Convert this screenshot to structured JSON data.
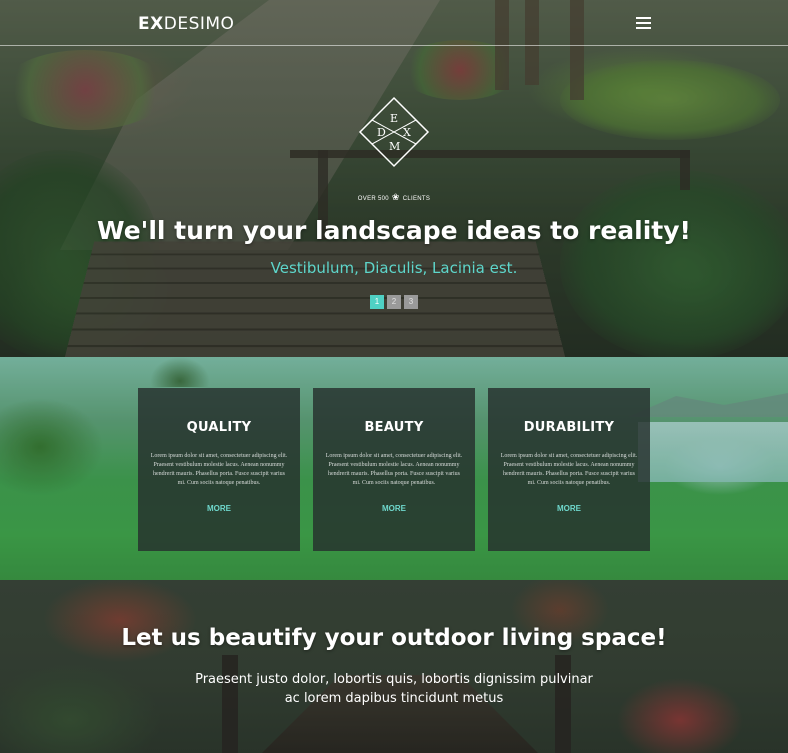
{
  "header": {
    "logo_bold": "EX",
    "logo_light": "DESIMO",
    "menu_icon": "hamburger-menu-icon"
  },
  "hero": {
    "emblem_letters": {
      "top": "E",
      "left": "D",
      "right": "X",
      "bottom": "M"
    },
    "clients_left": "OVER 500",
    "clients_right": "CLIENTS",
    "title": "We'll turn your landscape ideas to reality!",
    "subtitle": "Vestibulum, Diaculis, Lacinia est.",
    "pager": [
      "1",
      "2",
      "3"
    ],
    "pager_active": 0,
    "accent_color": "#4fd0c4"
  },
  "features": {
    "cards": [
      {
        "title": "QUALITY",
        "text": "Lorem ipsum dolor sit amet, consectetuer adipiscing elit. Praesent vestibulum molestie lacus. Aenean nonummy hendrerit mauris. Phasellus porta. Fusce suscipit varius mi. Cum sociis natoque penatibus.",
        "more": "MORE"
      },
      {
        "title": "BEAUTY",
        "text": "Lorem ipsum dolor sit amet, consectetuer adipiscing elit. Praesent vestibulum molestie lacus. Aenean nonummy hendrerit mauris. Phasellus porta. Fusce suscipit varius mi. Cum sociis natoque penatibus.",
        "more": "MORE"
      },
      {
        "title": "DURABILITY",
        "text": "Lorem ipsum dolor sit amet, consectetuer adipiscing elit. Praesent vestibulum molestie lacus. Aenean nonummy hendrerit mauris. Phasellus porta. Fusce suscipit varius mi. Cum sociis natoque penatibus.",
        "more": "MORE"
      }
    ]
  },
  "bottom": {
    "title": "Let us beautify your outdoor living space!",
    "text_line1": "Praesent justo dolor, lobortis quis, lobortis dignissim pulvinar",
    "text_line2": "ac lorem dapibus tincidunt metus"
  }
}
